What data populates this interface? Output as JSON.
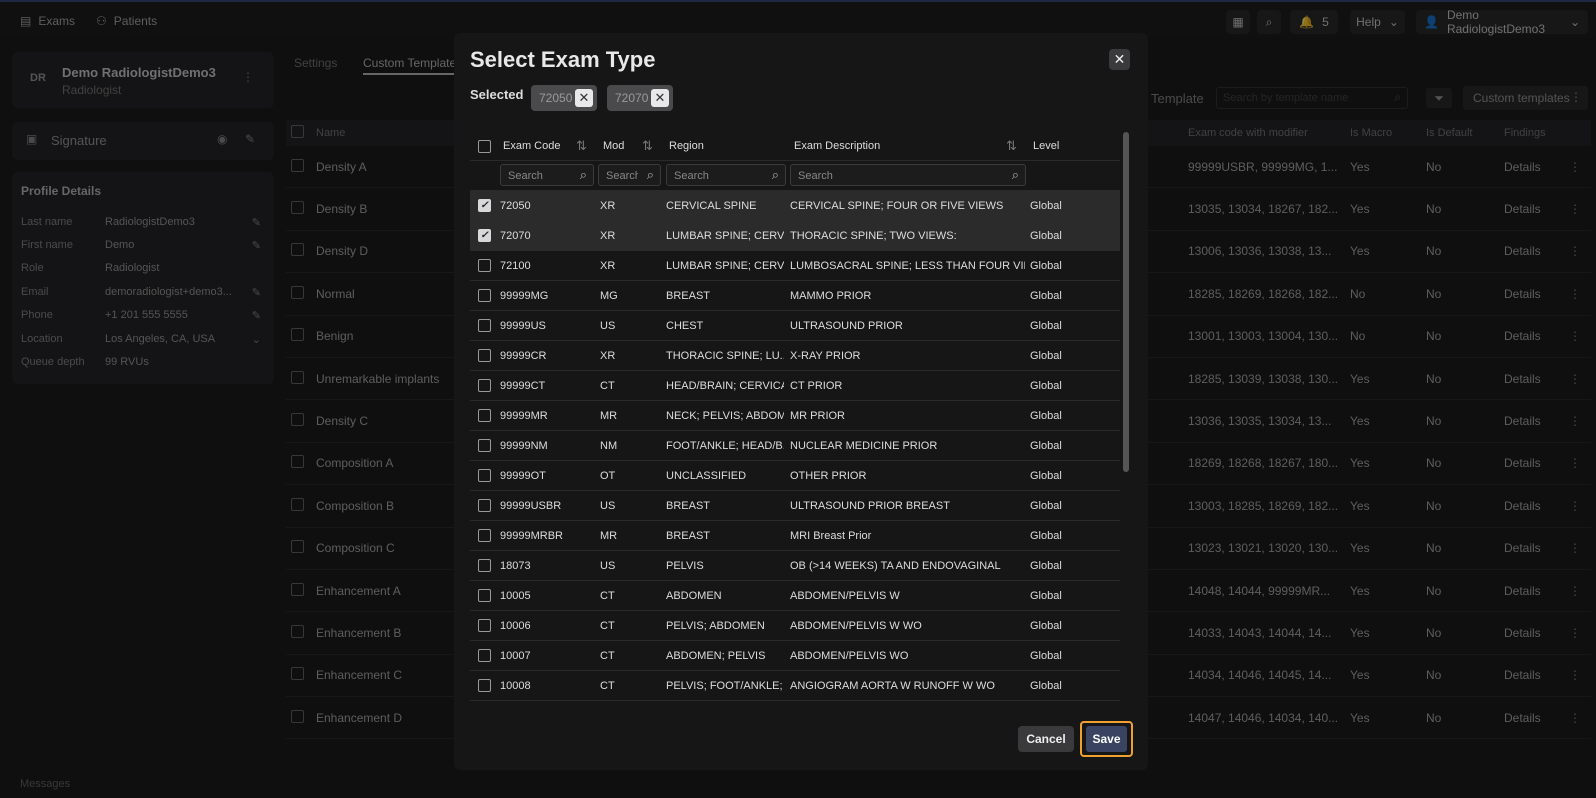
{
  "topbar": {
    "nav": [
      {
        "label": "Exams",
        "icon": "document-icon"
      },
      {
        "label": "Patients",
        "icon": "users-icon"
      }
    ],
    "notifications_count": "5",
    "help_label": "Help",
    "user_label": "Demo RadiologistDemo3"
  },
  "profile": {
    "initials": "DR",
    "name": "Demo RadiologistDemo3",
    "role": "Radiologist",
    "signature_label": "Signature",
    "details_title": "Profile Details",
    "fields": [
      {
        "key": "Last name",
        "value": "RadiologistDemo3",
        "editable": true
      },
      {
        "key": "First name",
        "value": "Demo",
        "editable": true
      },
      {
        "key": "Role",
        "value": "Radiologist",
        "editable": false
      },
      {
        "key": "Email",
        "value": "demoradiologist+demo3...",
        "editable": true
      },
      {
        "key": "Phone",
        "value": "+1 201 555 5555",
        "editable": true
      },
      {
        "key": "Location",
        "value": "Los Angeles, CA, USA",
        "editable": false
      },
      {
        "key": "Queue depth",
        "value": "99 RVUs",
        "editable": false
      }
    ]
  },
  "tabs": [
    "Settings",
    "Custom Templates"
  ],
  "toolbar": {
    "add_template_label": "t Template",
    "search_placeholder": "Search by template name",
    "custom_templates_label": "Custom templates"
  },
  "bg_table": {
    "headers": [
      "Name",
      "Exam code with modifier",
      "Is Macro",
      "Is Default",
      "Findings"
    ],
    "rows": [
      [
        "Density A",
        "99999USBR, 99999MG, 1...",
        "Yes",
        "No",
        "Details"
      ],
      [
        "Density B",
        "13035, 13034, 18267, 182...",
        "Yes",
        "No",
        "Details"
      ],
      [
        "Density D",
        "13006, 13036, 13038, 13...",
        "Yes",
        "No",
        "Details"
      ],
      [
        "Normal",
        "18285, 18269, 18268, 182...",
        "No",
        "No",
        "Details"
      ],
      [
        "Benign",
        "13001, 13003, 13004, 130...",
        "No",
        "No",
        "Details"
      ],
      [
        "Unremarkable implants",
        "18285, 13039, 13038, 130...",
        "Yes",
        "No",
        "Details"
      ],
      [
        "Density C",
        "13036, 13035, 13034, 13...",
        "Yes",
        "No",
        "Details"
      ],
      [
        "Composition A",
        "18269, 18268, 18267, 180...",
        "Yes",
        "No",
        "Details"
      ],
      [
        "Composition B",
        "13003, 18285, 18269, 182...",
        "Yes",
        "No",
        "Details"
      ],
      [
        "Composition C",
        "13023, 13021, 13020, 130...",
        "Yes",
        "No",
        "Details"
      ],
      [
        "Enhancement A",
        "14048, 14044, 99999MR...",
        "Yes",
        "No",
        "Details"
      ],
      [
        "Enhancement B",
        "14033, 14043, 14044, 14...",
        "Yes",
        "No",
        "Details"
      ],
      [
        "Enhancement C",
        "14034, 14046, 14045, 14...",
        "Yes",
        "No",
        "Details"
      ],
      [
        "Enhancement D",
        "14047, 14046, 14034, 140...",
        "Yes",
        "No",
        "Details"
      ]
    ]
  },
  "messages_label": "Messages",
  "modal": {
    "title": "Select Exam Type",
    "selected_label": "Selected",
    "chips": [
      "72050",
      "72070"
    ],
    "columns": [
      "Exam Code",
      "Mod",
      "Region",
      "Exam Description",
      "Level"
    ],
    "search_placeholder": "Search",
    "rows": [
      {
        "code": "72050",
        "mod": "XR",
        "region": "CERVICAL SPINE",
        "desc": "CERVICAL SPINE; FOUR OR FIVE VIEWS",
        "level": "Global",
        "checked": true
      },
      {
        "code": "72070",
        "mod": "XR",
        "region": "LUMBAR SPINE; CERVI...",
        "desc": "THORACIC SPINE; TWO VIEWS:",
        "level": "Global",
        "checked": true
      },
      {
        "code": "72100",
        "mod": "XR",
        "region": "LUMBAR SPINE; CERVI...",
        "desc": "LUMBOSACRAL SPINE; LESS THAN FOUR VIE...",
        "level": "Global",
        "checked": false
      },
      {
        "code": "99999MG",
        "mod": "MG",
        "region": "BREAST",
        "desc": "MAMMO PRIOR",
        "level": "Global",
        "checked": false
      },
      {
        "code": "99999US",
        "mod": "US",
        "region": "CHEST",
        "desc": "ULTRASOUND PRIOR",
        "level": "Global",
        "checked": false
      },
      {
        "code": "99999CR",
        "mod": "XR",
        "region": "THORACIC SPINE; LU...",
        "desc": "X-RAY PRIOR",
        "level": "Global",
        "checked": false
      },
      {
        "code": "99999CT",
        "mod": "CT",
        "region": "HEAD/BRAIN; CERVICA...",
        "desc": "CT PRIOR",
        "level": "Global",
        "checked": false
      },
      {
        "code": "99999MR",
        "mod": "MR",
        "region": "NECK; PELVIS; ABDOM...",
        "desc": "MR PRIOR",
        "level": "Global",
        "checked": false
      },
      {
        "code": "99999NM",
        "mod": "NM",
        "region": "FOOT/ANKLE; HEAD/B...",
        "desc": "NUCLEAR MEDICINE PRIOR",
        "level": "Global",
        "checked": false
      },
      {
        "code": "99999OT",
        "mod": "OT",
        "region": "UNCLASSIFIED",
        "desc": "OTHER PRIOR",
        "level": "Global",
        "checked": false
      },
      {
        "code": "99999USBR",
        "mod": "US",
        "region": "BREAST",
        "desc": "ULTRASOUND PRIOR BREAST",
        "level": "Global",
        "checked": false
      },
      {
        "code": "99999MRBR",
        "mod": "MR",
        "region": "BREAST",
        "desc": "MRI Breast Prior",
        "level": "Global",
        "checked": false
      },
      {
        "code": "18073",
        "mod": "US",
        "region": "PELVIS",
        "desc": "OB (>14 WEEKS) TA AND ENDOVAGINAL",
        "level": "Global",
        "checked": false
      },
      {
        "code": "10005",
        "mod": "CT",
        "region": "ABDOMEN",
        "desc": "ABDOMEN/PELVIS W",
        "level": "Global",
        "checked": false
      },
      {
        "code": "10006",
        "mod": "CT",
        "region": "PELVIS; ABDOMEN",
        "desc": "ABDOMEN/PELVIS W WO",
        "level": "Global",
        "checked": false
      },
      {
        "code": "10007",
        "mod": "CT",
        "region": "ABDOMEN; PELVIS",
        "desc": "ABDOMEN/PELVIS WO",
        "level": "Global",
        "checked": false
      },
      {
        "code": "10008",
        "mod": "CT",
        "region": "PELVIS; FOOT/ANKLE; ...",
        "desc": "ANGIOGRAM AORTA W RUNOFF W WO",
        "level": "Global",
        "checked": false
      }
    ],
    "cancel_label": "Cancel",
    "save_label": "Save"
  }
}
